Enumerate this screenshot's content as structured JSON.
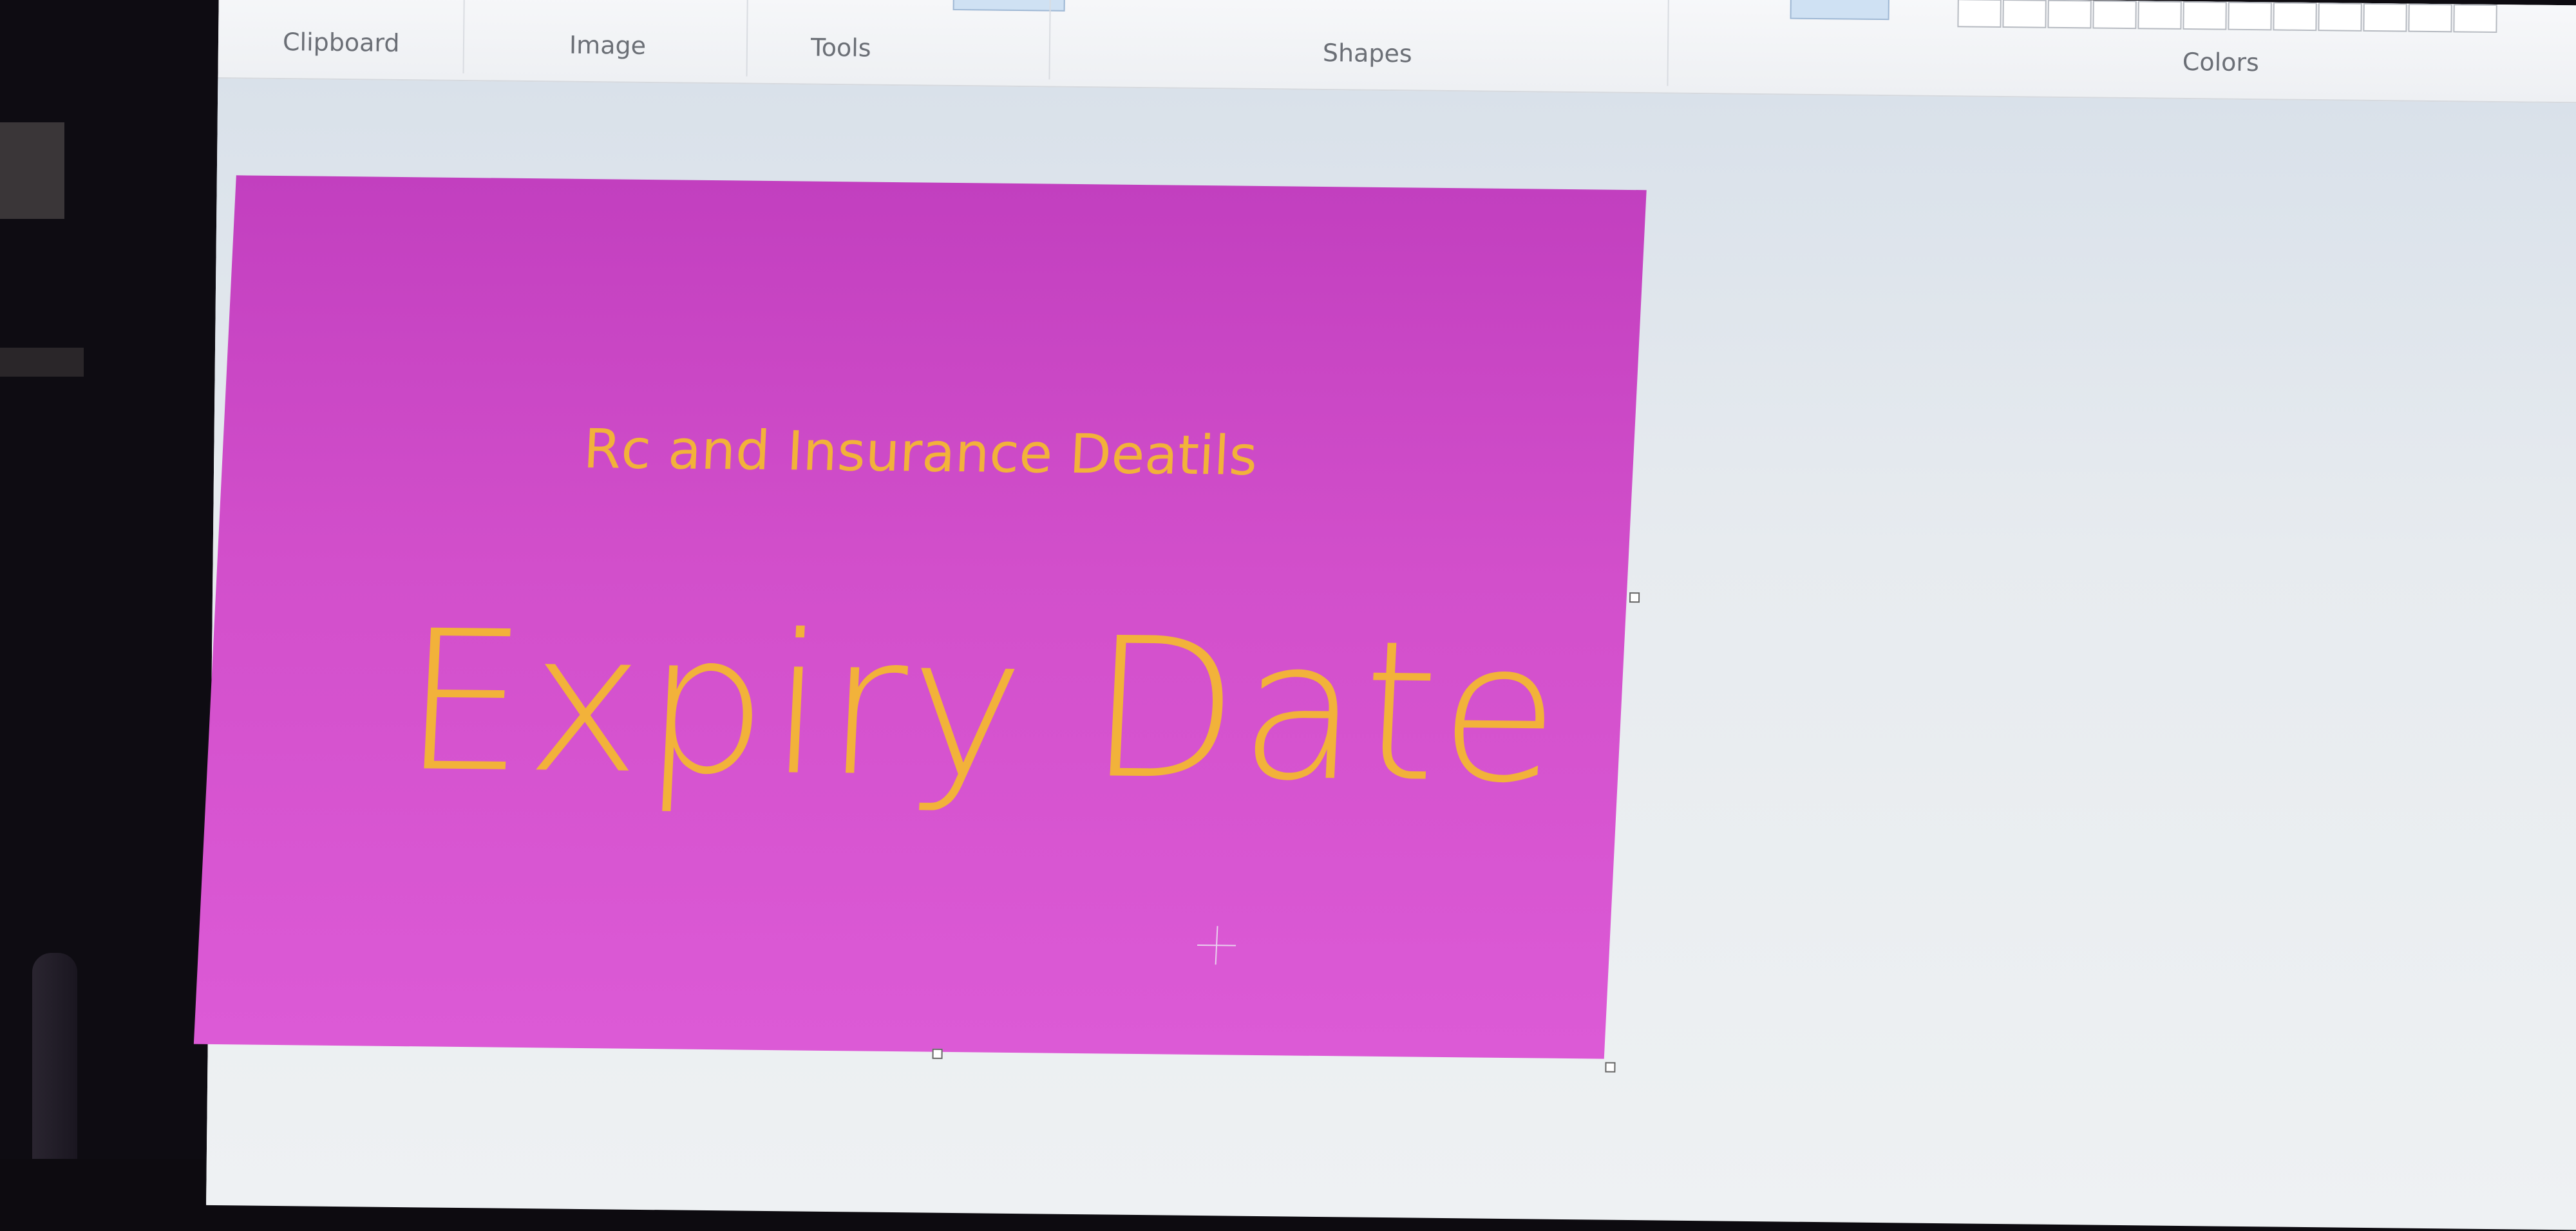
{
  "ribbon": {
    "groups": {
      "clipboard": "Clipboard",
      "image": "Image",
      "tools": "Tools",
      "shapes": "Shapes",
      "colors": "Colors"
    }
  },
  "canvas": {
    "title": "Rc and Insurance Deatils",
    "headline": "Expiry Date",
    "background_color": "#d24fcb",
    "text_color": "#f2b23a"
  },
  "icons": {
    "cursor": "crosshair-cursor-icon"
  }
}
